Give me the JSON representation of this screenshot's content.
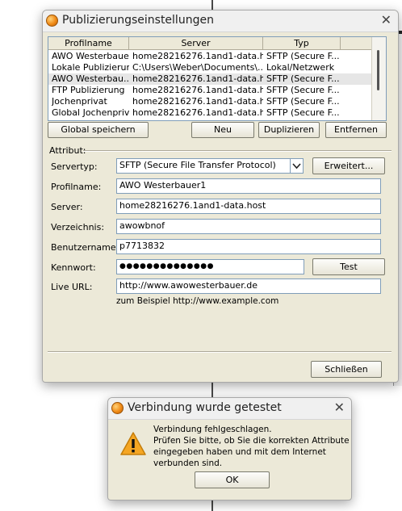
{
  "main_dialog": {
    "title": "Publizierungseinstellungen",
    "list": {
      "columns": [
        "Profilname",
        "Server",
        "Typ"
      ],
      "rows": [
        [
          "AWO Westerbauer",
          "home28216276.1and1-data.h...",
          "SFTP (Secure F..."
        ],
        [
          "Lokale Publizierung",
          "C:\\Users\\Weber\\Documents\\...",
          "Lokal/Netzwerk"
        ],
        [
          "AWO Westerbau...",
          "home28216276.1and1-data.h...",
          "SFTP (Secure F..."
        ],
        [
          "FTP Publizierung",
          "home28216276.1and1-data.h...",
          "SFTP (Secure F..."
        ],
        [
          "Jochenprivat",
          "home28216276.1and1-data.h...",
          "SFTP (Secure F..."
        ],
        [
          "Global Jochenprivat",
          "home28216276.1and1-data.h...",
          "SFTP (Secure F..."
        ]
      ]
    },
    "buttons": {
      "global_save": "Global speichern",
      "new": "Neu",
      "duplicate": "Duplizieren",
      "remove": "Entfernen",
      "advanced": "Erweitert...",
      "test": "Test",
      "close": "Schließen"
    },
    "attribute_label": "Attribut:",
    "fields": {
      "servertype": {
        "label": "Servertyp:",
        "value": "SFTP (Secure File Transfer Protocol)"
      },
      "profile": {
        "label": "Profilname:",
        "value": "AWO Westerbauer1"
      },
      "server": {
        "label": "Server:",
        "value": "home28216276.1and1-data.host"
      },
      "directory": {
        "label": "Verzeichnis:",
        "value": "awowbnof"
      },
      "username": {
        "label": "Benutzername:",
        "value": "p7713832"
      },
      "password": {
        "label": "Kennwort:",
        "value": "●●●●●●●●●●●●●●"
      },
      "live_url": {
        "label": "Live URL:",
        "value": "http://www.awowesterbauer.de"
      }
    },
    "example_hint": "zum Beispiel http://www.example.com"
  },
  "message_dialog": {
    "title": "Verbindung wurde getestet",
    "message": [
      "Verbindung fehlgeschlagen.",
      "Prüfen Sie bitte, ob Sie die korrekten Attribute",
      "eingegeben haben und mit dem Internet",
      "verbunden sind."
    ],
    "ok_label": "OK"
  },
  "colors": {
    "dialog_bg": "#ece9d8",
    "field_border": "#7f9db9",
    "warning": "#f5a623"
  }
}
